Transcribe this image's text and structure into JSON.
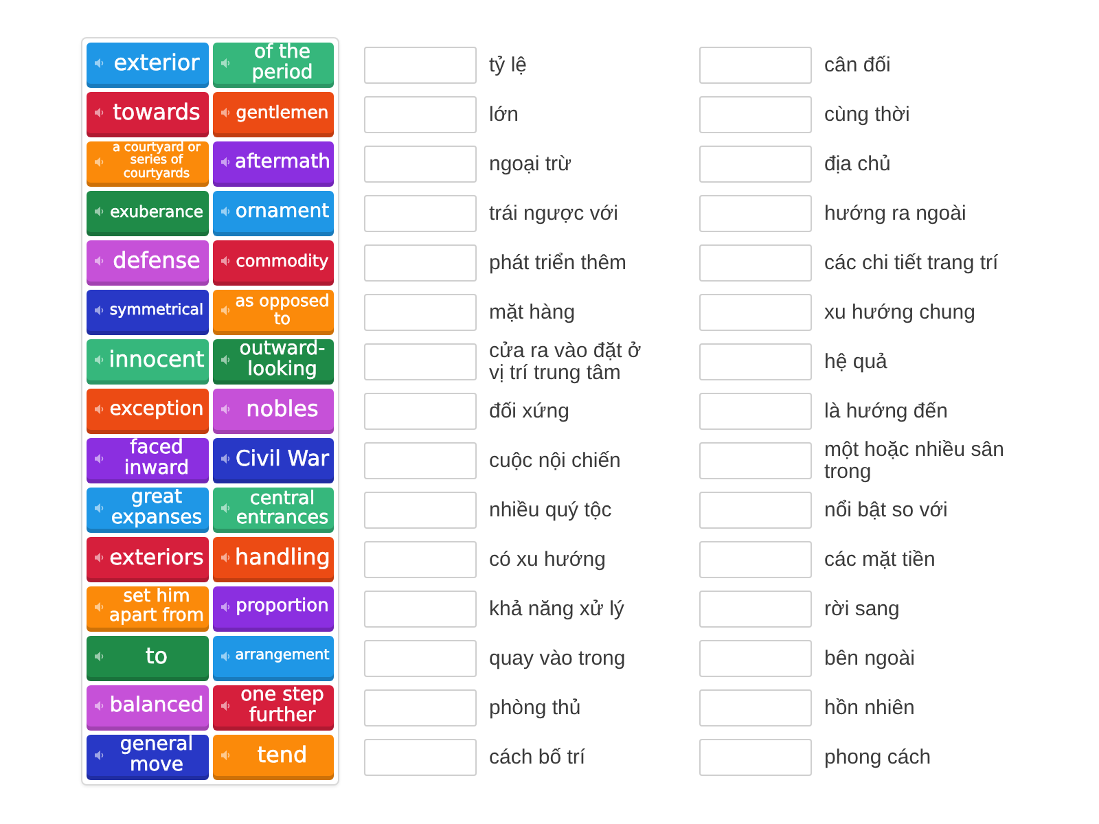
{
  "tile_rows": [
    {
      "tiles": [
        {
          "text": "exterior",
          "color": "#1f97e6"
        },
        {
          "text": "of the period",
          "color": "#36b77c"
        }
      ]
    },
    {
      "tiles": [
        {
          "text": "towards",
          "color": "#d61f3c"
        },
        {
          "text": "gentlemen",
          "color": "#ec4b14"
        }
      ]
    },
    {
      "tiles": [
        {
          "text": "a courtyard or series of courtyards",
          "color": "#fb8a0a"
        },
        {
          "text": "aftermath",
          "color": "#8b2fe0"
        }
      ]
    },
    {
      "tiles": [
        {
          "text": "exuberance",
          "color": "#1f8b48"
        },
        {
          "text": "ornament",
          "color": "#1f97e6"
        }
      ]
    },
    {
      "tiles": [
        {
          "text": "defense",
          "color": "#c651d8"
        },
        {
          "text": "commodity",
          "color": "#d61f3c"
        }
      ]
    },
    {
      "tiles": [
        {
          "text": "symmetrical",
          "color": "#2838c6"
        },
        {
          "text": "as opposed to",
          "color": "#fb8a0a"
        }
      ]
    },
    {
      "tiles": [
        {
          "text": "innocent",
          "color": "#36b77c"
        },
        {
          "text": "outward-looking",
          "color": "#1f8b48"
        }
      ]
    },
    {
      "tiles": [
        {
          "text": "exception",
          "color": "#ec4b14"
        },
        {
          "text": "nobles",
          "color": "#c651d8"
        }
      ]
    },
    {
      "tiles": [
        {
          "text": "faced inward",
          "color": "#8b2fe0"
        },
        {
          "text": "Civil War",
          "color": "#2838c6"
        }
      ]
    },
    {
      "tiles": [
        {
          "text": "great expanses",
          "color": "#1f97e6"
        },
        {
          "text": "central entrances",
          "color": "#36b77c"
        }
      ]
    },
    {
      "tiles": [
        {
          "text": "exteriors",
          "color": "#d61f3c"
        },
        {
          "text": "handling",
          "color": "#ec4b14"
        }
      ]
    },
    {
      "tiles": [
        {
          "text": "set him apart from",
          "color": "#fb8a0a"
        },
        {
          "text": "proportion",
          "color": "#8b2fe0"
        }
      ]
    },
    {
      "tiles": [
        {
          "text": "to",
          "color": "#1f8b48"
        },
        {
          "text": "arrangement",
          "color": "#1f97e6"
        }
      ]
    },
    {
      "tiles": [
        {
          "text": "balanced",
          "color": "#c651d8"
        },
        {
          "text": "one step further",
          "color": "#d61f3c"
        }
      ]
    },
    {
      "tiles": [
        {
          "text": "general move",
          "color": "#2838c6"
        },
        {
          "text": "tend",
          "color": "#fb8a0a"
        }
      ]
    }
  ],
  "match_columns": [
    {
      "items": [
        {
          "text": "tỷ lệ"
        },
        {
          "text": "lớn"
        },
        {
          "text": "ngoại trừ"
        },
        {
          "text": "trái ngược với"
        },
        {
          "text": "phát triển thêm"
        },
        {
          "text": "mặt hàng"
        },
        {
          "text": "cửa ra vào đặt ở vị trí trung tâm"
        },
        {
          "text": "đối xứng"
        },
        {
          "text": "cuộc nội chiến"
        },
        {
          "text": "nhiều quý tộc"
        },
        {
          "text": "có xu hướng"
        },
        {
          "text": "khả năng xử lý"
        },
        {
          "text": "quay vào trong"
        },
        {
          "text": "phòng thủ"
        },
        {
          "text": "cách bố trí"
        }
      ]
    },
    {
      "items": [
        {
          "text": "cân đối"
        },
        {
          "text": "cùng thời"
        },
        {
          "text": "địa chủ"
        },
        {
          "text": "hướng ra ngoài"
        },
        {
          "text": "các chi tiết trang trí"
        },
        {
          "text": "xu hướng chung"
        },
        {
          "text": "hệ quả"
        },
        {
          "text": "là hướng đến"
        },
        {
          "text": "một hoặc nhiều sân trong"
        },
        {
          "text": "nổi bật so với"
        },
        {
          "text": "các mặt tiền"
        },
        {
          "text": "rời sang"
        },
        {
          "text": "bên ngoài"
        },
        {
          "text": "hồn nhiên"
        },
        {
          "text": "phong cách"
        }
      ]
    }
  ]
}
